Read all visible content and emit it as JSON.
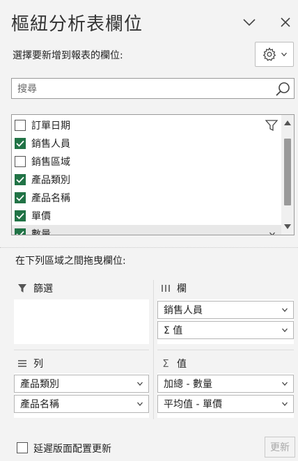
{
  "pane": {
    "title": "樞紐分析表欄位",
    "choose_fields_label": "選擇要新增到報表的欄位:"
  },
  "search": {
    "placeholder": "搜尋",
    "value": ""
  },
  "fields": [
    {
      "label": "訂單日期",
      "checked": false
    },
    {
      "label": "銷售人員",
      "checked": true
    },
    {
      "label": "銷售區域",
      "checked": false
    },
    {
      "label": "產品類別",
      "checked": true
    },
    {
      "label": "產品名稱",
      "checked": true
    },
    {
      "label": "單價",
      "checked": true
    },
    {
      "label": "數量",
      "checked": true
    }
  ],
  "drag_label": "在下列區域之間拖曳欄位:",
  "areas": {
    "filters": {
      "label": "篩選",
      "items": []
    },
    "columns": {
      "label": "欄",
      "items": [
        "銷售人員",
        "Σ 值"
      ]
    },
    "rows": {
      "label": "列",
      "items": [
        "產品類別",
        "產品名稱"
      ]
    },
    "values": {
      "label": "值",
      "items": [
        "加總 - 數量",
        "平均值 - 單價"
      ]
    }
  },
  "footer": {
    "defer_label": "延遲版面配置更新",
    "defer_checked": false,
    "update_label": "更新"
  },
  "colors": {
    "checkbox_checked": "#217346",
    "pane_bg": "#f3f3f3"
  },
  "icons": [
    "chevron-down-icon",
    "close-icon",
    "gear-icon",
    "search-icon",
    "filter-icon",
    "columns-icon",
    "rows-icon",
    "sigma-icon"
  ]
}
